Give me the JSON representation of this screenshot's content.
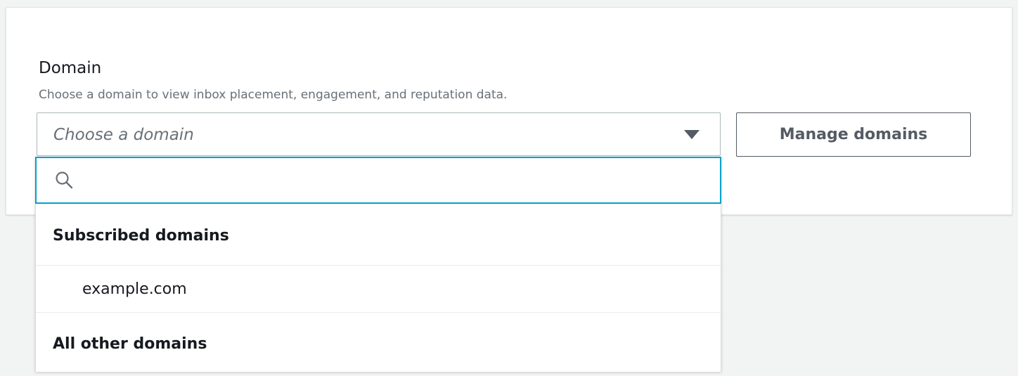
{
  "domain_field": {
    "label": "Domain",
    "description": "Choose a domain to view inbox placement, engagement, and reputation data.",
    "placeholder": "Choose a domain",
    "caret_icon": "caret-down-icon"
  },
  "manage_button": {
    "label": "Manage domains"
  },
  "dropdown": {
    "search": {
      "icon": "search-icon",
      "value": "",
      "placeholder": ""
    },
    "groups": [
      {
        "header": "Subscribed domains",
        "options": [
          "example.com"
        ]
      },
      {
        "header": "All other domains",
        "options": []
      }
    ]
  },
  "colors": {
    "focus_border": "#00a1c9",
    "text_primary": "#16191f",
    "text_secondary": "#687078",
    "button_text": "#545b64",
    "page_background": "#f2f3f3"
  }
}
